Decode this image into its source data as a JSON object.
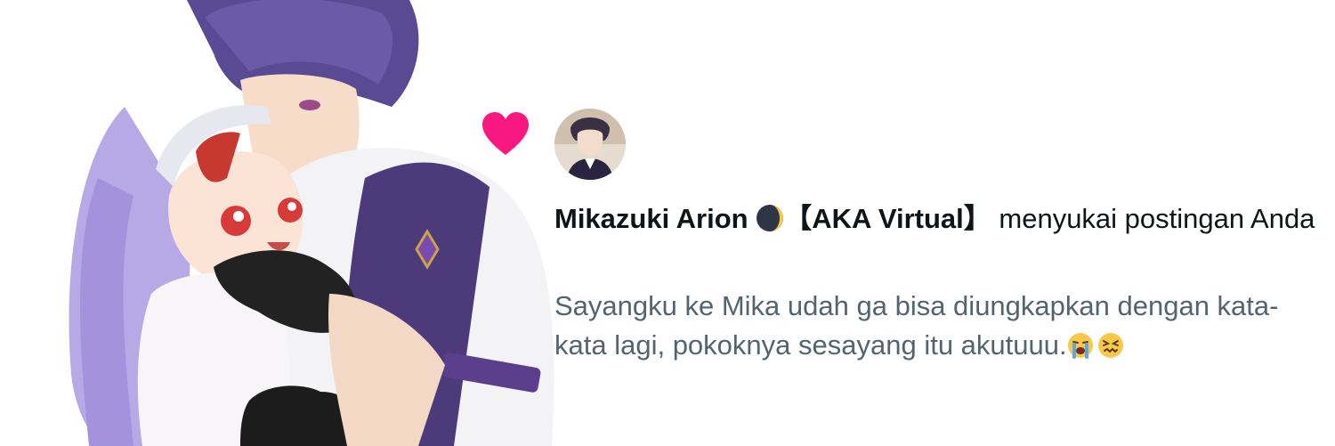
{
  "notification": {
    "icon": "heart-icon",
    "icon_color": "#f91880",
    "user_name": "Mikazuki Arion",
    "user_tag": "【AKA Virtual】",
    "moon_icon": "moon-emoji",
    "action_text": "menyukai postingan Anda",
    "post_text": "Sayangku ke Mika udah ga bisa diungkapkan dengan kata-kata lagi, pokoknya sesayang itu akutuuu.",
    "emojis": [
      "loudly-crying-face-emoji",
      "confounded-face-emoji"
    ]
  },
  "colors": {
    "primary_text": "#0f1419",
    "secondary_text": "#536471",
    "heart": "#f91880"
  }
}
